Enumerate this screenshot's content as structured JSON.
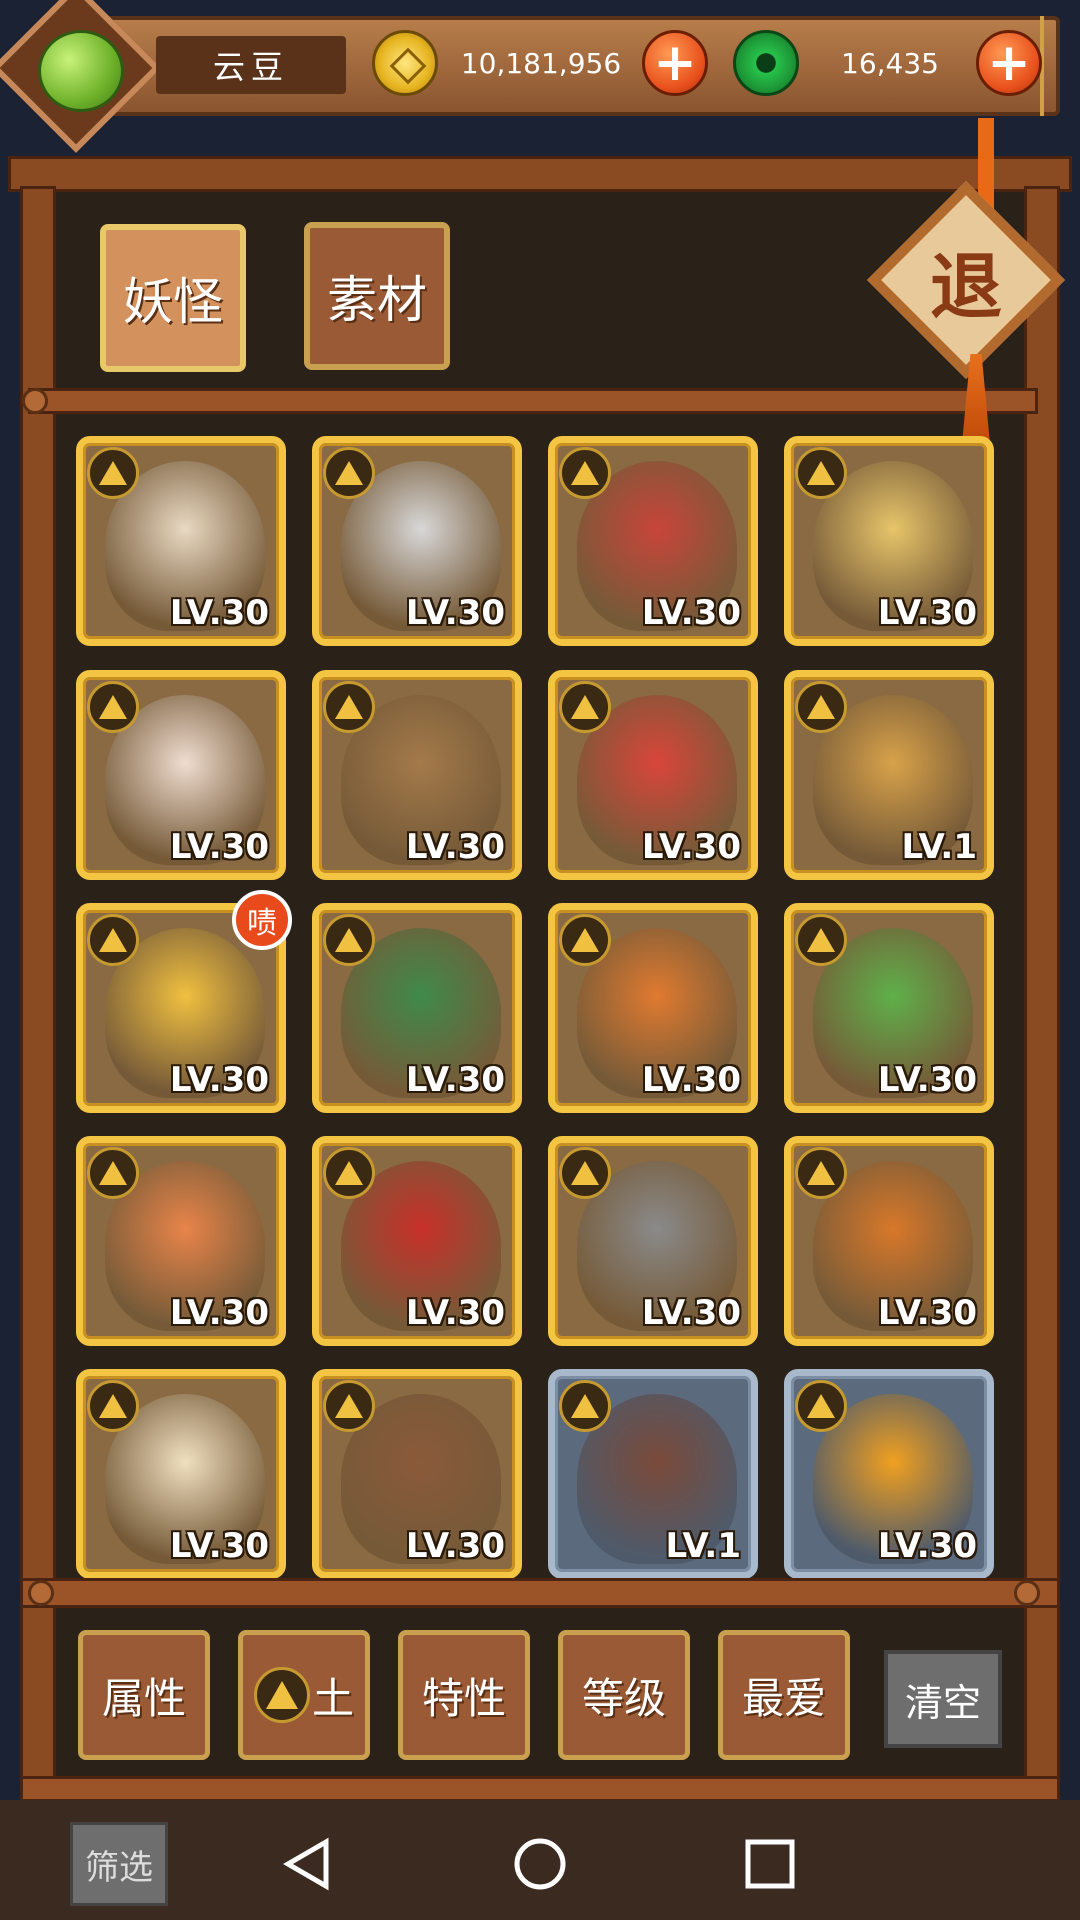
{
  "header": {
    "player_name": "云豆",
    "gold_amount": "10,181,956",
    "jade_amount": "16,435",
    "add_label": "+"
  },
  "tabs": [
    {
      "label": "妖怪",
      "active": true
    },
    {
      "label": "素材",
      "active": false
    }
  ],
  "exit_label": "退",
  "grid": [
    {
      "level": "LV.30",
      "frame": "gold",
      "color": "#e9d9c3"
    },
    {
      "level": "LV.30",
      "frame": "gold",
      "color": "#d8d8d8"
    },
    {
      "level": "LV.30",
      "frame": "gold",
      "color": "#c8453a"
    },
    {
      "level": "LV.30",
      "frame": "gold",
      "color": "#e7c56a"
    },
    {
      "level": "LV.30",
      "frame": "gold",
      "color": "#f0ddd0"
    },
    {
      "level": "LV.30",
      "frame": "gold",
      "color": "#a47a4a"
    },
    {
      "level": "LV.30",
      "frame": "gold",
      "color": "#d9453a"
    },
    {
      "level": "LV.1",
      "frame": "gold",
      "color": "#d8a24a"
    },
    {
      "level": "LV.30",
      "frame": "gold",
      "color": "#f0c040"
    },
    {
      "level": "LV.30",
      "frame": "gold",
      "color": "#3f8a4a"
    },
    {
      "level": "LV.30",
      "frame": "gold",
      "color": "#e07a30"
    },
    {
      "level": "LV.30",
      "frame": "gold",
      "color": "#5fb04a"
    },
    {
      "level": "LV.30",
      "frame": "gold",
      "color": "#e8844a"
    },
    {
      "level": "LV.30",
      "frame": "gold",
      "color": "#c8302a"
    },
    {
      "level": "LV.30",
      "frame": "gold",
      "color": "#8a8a8a"
    },
    {
      "level": "LV.30",
      "frame": "gold",
      "color": "#d8782a"
    },
    {
      "level": "LV.30",
      "frame": "gold",
      "color": "#f0e0c0"
    },
    {
      "level": "LV.30",
      "frame": "gold",
      "color": "#8a5a3a"
    },
    {
      "level": "LV.1",
      "frame": "silver",
      "color": "#7a4a3a"
    },
    {
      "level": "LV.30",
      "frame": "silver",
      "color": "#f0a020"
    }
  ],
  "notification_badge": "啧",
  "filters": {
    "attribute": "属性",
    "earth": "土",
    "trait": "特性",
    "level": "等级",
    "favorite": "最爱",
    "clear": "清空"
  },
  "screen_filter_label": "筛选"
}
